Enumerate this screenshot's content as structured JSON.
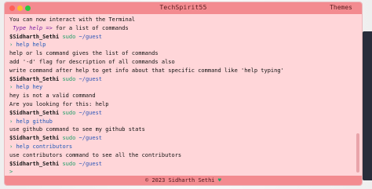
{
  "window": {
    "title": "TechSpirit55",
    "themes_label": "Themes",
    "controls": [
      {
        "name": "close",
        "color": "#ff5f57"
      },
      {
        "name": "minimize",
        "color": "#febc2e"
      },
      {
        "name": "maximize",
        "color": "#28c840"
      }
    ]
  },
  "terminal": {
    "line1": "You can now interact with the Terminal",
    "line2_pre": " ",
    "line2_italic": "Type help",
    "line2_arrow": " => ",
    "line2_rest": "for a list of commands",
    "prompt_user": "$Sidharth_Sethi",
    "prompt_cmd": "sudo",
    "prompt_path": "~/guest",
    "cmd1": "help help",
    "out1a": "help or ls command gives the list of commands",
    "out1b": "add '-d' flag for description of all commands also",
    "out1c": "write command after help to get info about that specific command like 'help typing'",
    "cmd2": "help hey",
    "out2a": "hey is not a valid command",
    "out2b": "Are you looking for this: help",
    "cmd3": "help github",
    "out3a": "use github command to see my github stats",
    "cmd4": "help contributors",
    "out4a": "use contributors command to see all the contributors",
    "cursor_prompt": ">",
    "cursor_arrow": "›"
  },
  "footer": {
    "text": "© 2023 Sidharth Sethi",
    "heart": "♥"
  }
}
